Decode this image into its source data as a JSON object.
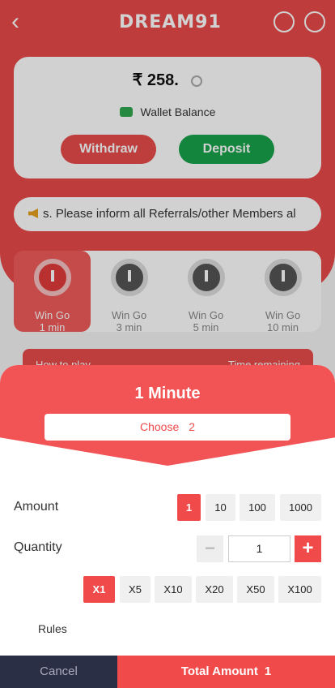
{
  "header": {
    "back_icon": "chevron-left-icon",
    "logo_text": "DREAM91",
    "support_icon": "headset-icon",
    "music_icon": "music-note-icon"
  },
  "wallet": {
    "balance": "₹ 258.",
    "label": "Wallet Balance",
    "withdraw_label": "Withdraw",
    "deposit_label": "Deposit"
  },
  "notice": {
    "text": "s. Please inform all Referrals/other Members al"
  },
  "game_tabs": [
    {
      "line1": "Win Go",
      "line2": "1 min",
      "active": true
    },
    {
      "line1": "Win Go",
      "line2": "3 min",
      "active": false
    },
    {
      "line1": "Win Go",
      "line2": "5 min",
      "active": false
    },
    {
      "line1": "Win Go",
      "line2": "10 min",
      "active": false
    }
  ],
  "howto": {
    "left": "How to play",
    "right": "Time remaining"
  },
  "sheet": {
    "title": "1 Minute",
    "choose_label": "Choose",
    "choose_value": "2",
    "amount_label": "Amount",
    "amount_options": [
      "1",
      "10",
      "100",
      "1000"
    ],
    "amount_selected": "1",
    "quantity_label": "Quantity",
    "quantity_minus": "−",
    "quantity_value": "1",
    "quantity_plus": "+",
    "multipliers": [
      "X1",
      "X5",
      "X10",
      "X20",
      "X50",
      "X100"
    ],
    "multiplier_selected": "X1",
    "rules_label": "Rules"
  },
  "footer": {
    "cancel_label": "Cancel",
    "total_label": "Total Amount",
    "total_value": "1"
  },
  "colors": {
    "accent": "#f04a4a",
    "deposit_green": "#18a34a",
    "footer_dark": "#2a2f45"
  }
}
